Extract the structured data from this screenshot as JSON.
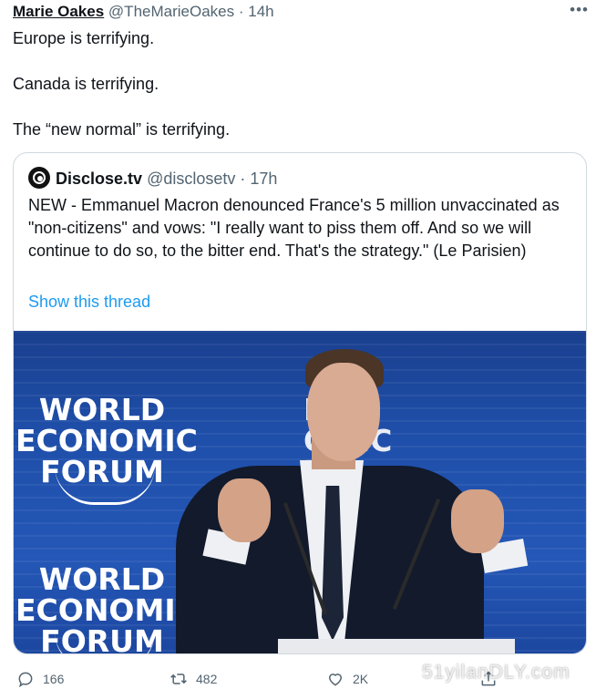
{
  "tweet": {
    "author_name": "Marie Oakes",
    "handle": "@TheMarieOakes",
    "separator": "·",
    "time": "14h",
    "more_label": "•••",
    "lines": [
      "Europe is terrifying.",
      "Canada is terrifying.",
      "The “new normal” is terrifying."
    ]
  },
  "quote": {
    "name": "Disclose.tv",
    "handle": "@disclosetv",
    "separator": "·",
    "time": "17h",
    "text": "NEW - Emmanuel Macron denounced France's 5 million unvaccinated as \"non-citizens\" and vows: \"I really want to piss them off. And so we will continue to do so, to the bitter end. That's the strategy.\" (Le Parisien)",
    "thread_link": "Show this thread",
    "photo": {
      "backdrop_text_1": [
        "WORLD",
        "ECONOMIC",
        "FORUM"
      ],
      "backdrop_text_2": [
        "WORLD",
        "ECONOMIC",
        "FORUM"
      ],
      "backdrop_text_3": [
        "LD",
        "OMIC",
        "M"
      ]
    }
  },
  "actions": {
    "reply_count": "166",
    "retweet_count": "482",
    "like_count": "2K"
  },
  "watermark": "51yilanDLY.com",
  "colors": {
    "link": "#1d9bf0",
    "secondary_text": "#536471",
    "border": "#cfd9de",
    "photo_backdrop": "#1e4ea8"
  }
}
